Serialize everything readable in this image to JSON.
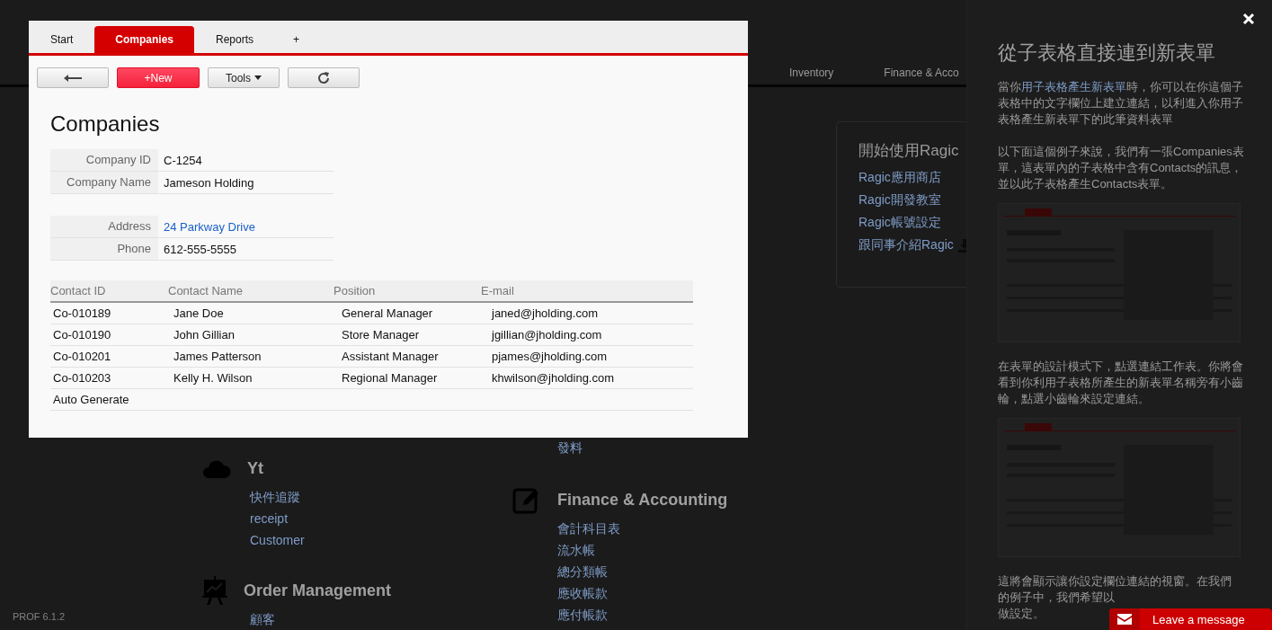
{
  "background_page": {
    "nav": [
      "Inventory",
      "Finance & Acco"
    ],
    "getting_started": {
      "title": "開始使用Ragic",
      "links": [
        "Ragic應用商店",
        "Ragic開發教室",
        "Ragic帳號設定",
        "跟同事介紹Ragic"
      ]
    },
    "columns": [
      {
        "sections": [
          {
            "kind": "cloud",
            "title": "Yt",
            "links": [
              "快件追蹤",
              "receipt",
              "Customer"
            ]
          },
          {
            "kind": "easel",
            "title": "Order Management",
            "links": [
              "顧客"
            ]
          }
        ]
      },
      {
        "sections": [
          {
            "links": [
              "發料"
            ]
          },
          {
            "kind": "edit",
            "title": "Finance & Accounting",
            "links": [
              "會計科目表",
              "流水帳",
              "總分類帳",
              "應收帳款",
              "應付帳款"
            ]
          }
        ]
      }
    ],
    "version": "PROF 6.1.2"
  },
  "modal": {
    "tabs": [
      {
        "label": "Start",
        "selected": false
      },
      {
        "label": "Companies",
        "selected": true
      },
      {
        "label": "Reports",
        "selected": false
      },
      {
        "label": "+",
        "selected": false
      }
    ],
    "toolbar": [
      {
        "kind": "back"
      },
      {
        "kind": "primary",
        "label": "+New"
      },
      {
        "kind": "menu",
        "label": "Tools"
      },
      {
        "kind": "refresh"
      }
    ],
    "title": "Companies",
    "field_groups": [
      [
        {
          "label": "Company ID",
          "value": "C-1254",
          "kind": "text"
        },
        {
          "label": "Company Name",
          "value": "Jameson Holding",
          "kind": "text"
        }
      ],
      [
        {
          "label": "Address",
          "value": "24 Parkway Drive",
          "kind": "link"
        },
        {
          "label": "Phone",
          "value": "612-555-5555",
          "kind": "text"
        }
      ]
    ],
    "subtable": {
      "columns": [
        "Contact ID",
        "Contact Name",
        "Position",
        "E-mail"
      ],
      "rows": [
        [
          "Co-010189",
          "Jane Doe",
          "General Manager",
          "janed@jholding.com"
        ],
        [
          "Co-010190",
          "John Gillian",
          "Store Manager",
          "jgillian@jholding.com"
        ],
        [
          "Co-010201",
          "James Patterson",
          "Assistant Manager",
          "pjames@jholding.com"
        ],
        [
          "Co-010203",
          "Kelly H. Wilson",
          "Regional Manager",
          "khwilson@jholding.com"
        ]
      ],
      "footer": "Auto Generate"
    }
  },
  "help_panel": {
    "title": "從子表格直接連到新表單",
    "blocks": [
      {
        "kind": "text",
        "before": "當你",
        "link": "用子表格產生新表單",
        "after": "時，你可以在你這個子表格中的文字欄位上建立連結，以利進入你用子表格產生新表單下的此筆資料表單"
      },
      {
        "kind": "text",
        "after": "以下面這個例子來說，我們有一張Companies表單，這表單內的子表格中含有Contacts的訊息，並以此子表格產生Contacts表單。"
      },
      {
        "kind": "picture"
      },
      {
        "kind": "text",
        "after": "在表單的設計模式下，點選連結工作表。你將會看到你利用子表格所產生的新表單名稱旁有小齒輪，點選小齒輪來設定連結。"
      },
      {
        "kind": "picture"
      },
      {
        "kind": "lines",
        "lines": [
          "這將會顯示讓你設定欄位連結的視窗。在我們",
          "的例子中，我們希望以",
          "做設定。"
        ]
      }
    ]
  },
  "chat_button": "Leave a message"
}
